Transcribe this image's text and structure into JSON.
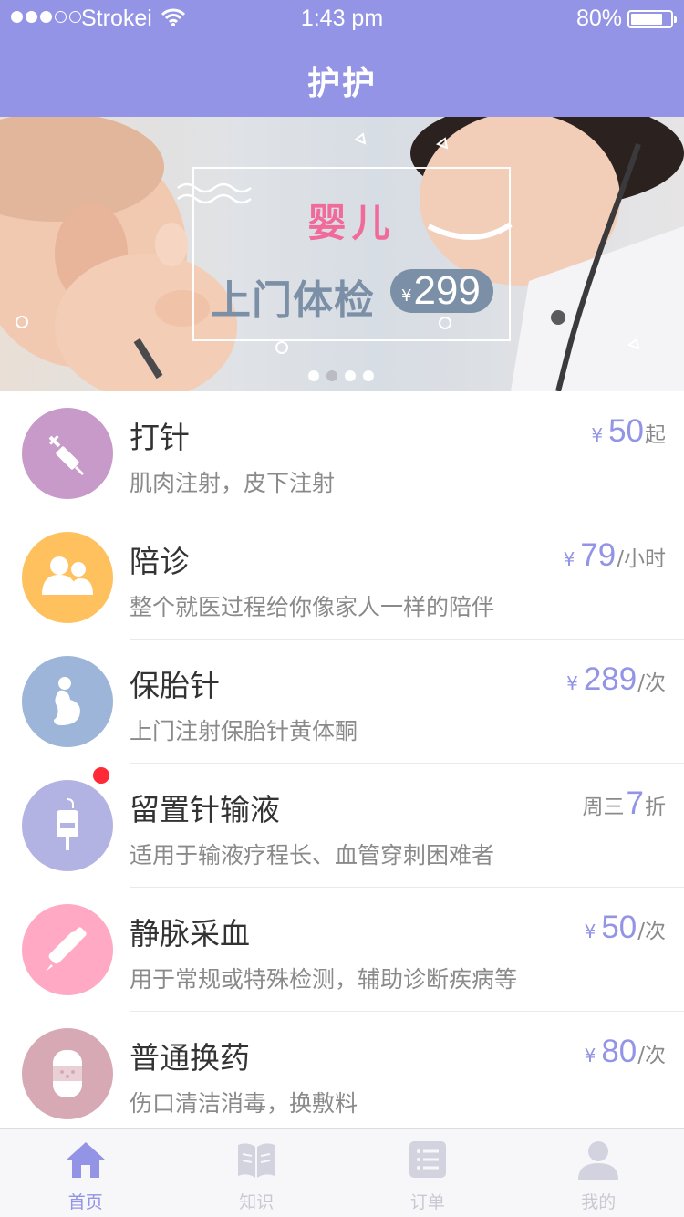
{
  "status_bar": {
    "carrier": "Strokei",
    "time": "1:43 pm",
    "battery": "80%",
    "battery_level": 0.8
  },
  "header": {
    "title": "护护"
  },
  "banner": {
    "brand": "婴儿",
    "headline": "上门体检",
    "currency": "¥",
    "price": "299",
    "slides": 4,
    "active_slide": 1
  },
  "services": [
    {
      "name": "打针",
      "desc": "肌肉注射，皮下注射",
      "currency": "¥",
      "prefix": "",
      "amount": "50",
      "unit": "起",
      "icon": "syringe-icon",
      "color": "#c79ac9",
      "badge": false
    },
    {
      "name": "陪诊",
      "desc": "整个就医过程给你像家人一样的陪伴",
      "currency": "¥",
      "prefix": "",
      "amount": "79",
      "unit": "/小时",
      "icon": "people-icon",
      "color": "#ffc15e",
      "badge": false
    },
    {
      "name": "保胎针",
      "desc": "上门注射保胎针黄体酮",
      "currency": "¥",
      "prefix": "",
      "amount": "289",
      "unit": "/次",
      "icon": "pregnant-icon",
      "color": "#9cb5d8",
      "badge": false
    },
    {
      "name": "留置针输液",
      "desc": "适用于输液疗程长、血管穿刺困难者",
      "currency": "",
      "prefix": "周三",
      "amount": "7",
      "unit": "折",
      "icon": "iv-bag-icon",
      "color": "#b2b3e3",
      "badge": true
    },
    {
      "name": "静脉采血",
      "desc": "用于常规或特殊检测，辅助诊断疾病等",
      "currency": "¥",
      "prefix": "",
      "amount": "50",
      "unit": "/次",
      "icon": "dropper-icon",
      "color": "#ffa9c4",
      "badge": false
    },
    {
      "name": "普通换药",
      "desc": "伤口清洁消毒，换敷料",
      "currency": "¥",
      "prefix": "",
      "amount": "80",
      "unit": "/次",
      "icon": "bandage-icon",
      "color": "#d6a9b4",
      "badge": false
    }
  ],
  "tabs": [
    {
      "label": "首页",
      "icon": "home-icon",
      "active": true
    },
    {
      "label": "知识",
      "icon": "book-icon",
      "active": false
    },
    {
      "label": "订单",
      "icon": "order-list-icon",
      "active": false
    },
    {
      "label": "我的",
      "icon": "profile-icon",
      "active": false
    }
  ],
  "colors": {
    "accent": "#9394e6",
    "price": "#9394e6",
    "text": "#333333",
    "muted": "#8a8a8a",
    "badge": "#ff2a36"
  }
}
